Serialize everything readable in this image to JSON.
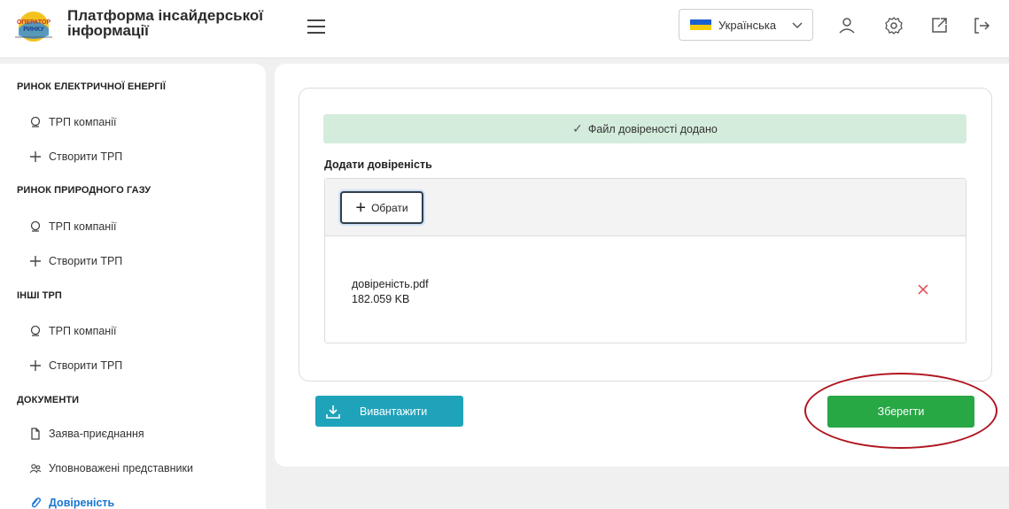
{
  "header": {
    "title": "Платформа інсайдерської інформації",
    "logo_text_top": "ОПЕРАТОР",
    "logo_text_mid": "РИНКУ",
    "language": "Українська"
  },
  "sidebar": {
    "sections": [
      {
        "title": "РИНОК ЕЛЕКТРИЧНОЇ ЕНЕРГІЇ",
        "items": [
          {
            "label": "ТРП компанії",
            "icon": "search-icon"
          },
          {
            "label": "Створити ТРП",
            "icon": "plus-icon"
          }
        ]
      },
      {
        "title": "РИНОК ПРИРОДНОГО ГАЗУ",
        "items": [
          {
            "label": "ТРП компанії",
            "icon": "search-icon"
          },
          {
            "label": "Створити ТРП",
            "icon": "plus-icon"
          }
        ]
      },
      {
        "title": "ІНШІ ТРП",
        "items": [
          {
            "label": "ТРП компанії",
            "icon": "search-icon"
          },
          {
            "label": "Створити ТРП",
            "icon": "plus-icon"
          }
        ]
      },
      {
        "title": "ДОКУМЕНТИ",
        "items": [
          {
            "label": "Заява-приєднання",
            "icon": "file-icon"
          },
          {
            "label": "Уповноважені представники",
            "icon": "users-icon"
          },
          {
            "label": "Довіреність",
            "icon": "paperclip-icon",
            "active": true
          }
        ]
      }
    ]
  },
  "main": {
    "success_message": "Файл довіреності додано",
    "add_label": "Додати довіреність",
    "choose_label": "Обрати",
    "file": {
      "name": "довіреність.pdf",
      "size": "182.059 KB"
    },
    "download_label": "Вивантажити",
    "save_label": "Зберегти"
  },
  "colors": {
    "accent": "#1976d2",
    "success_bg": "#d4ecdc",
    "download": "#1fa3ba",
    "save": "#28a745",
    "highlight": "#b0151f",
    "remove": "#e0454f"
  }
}
